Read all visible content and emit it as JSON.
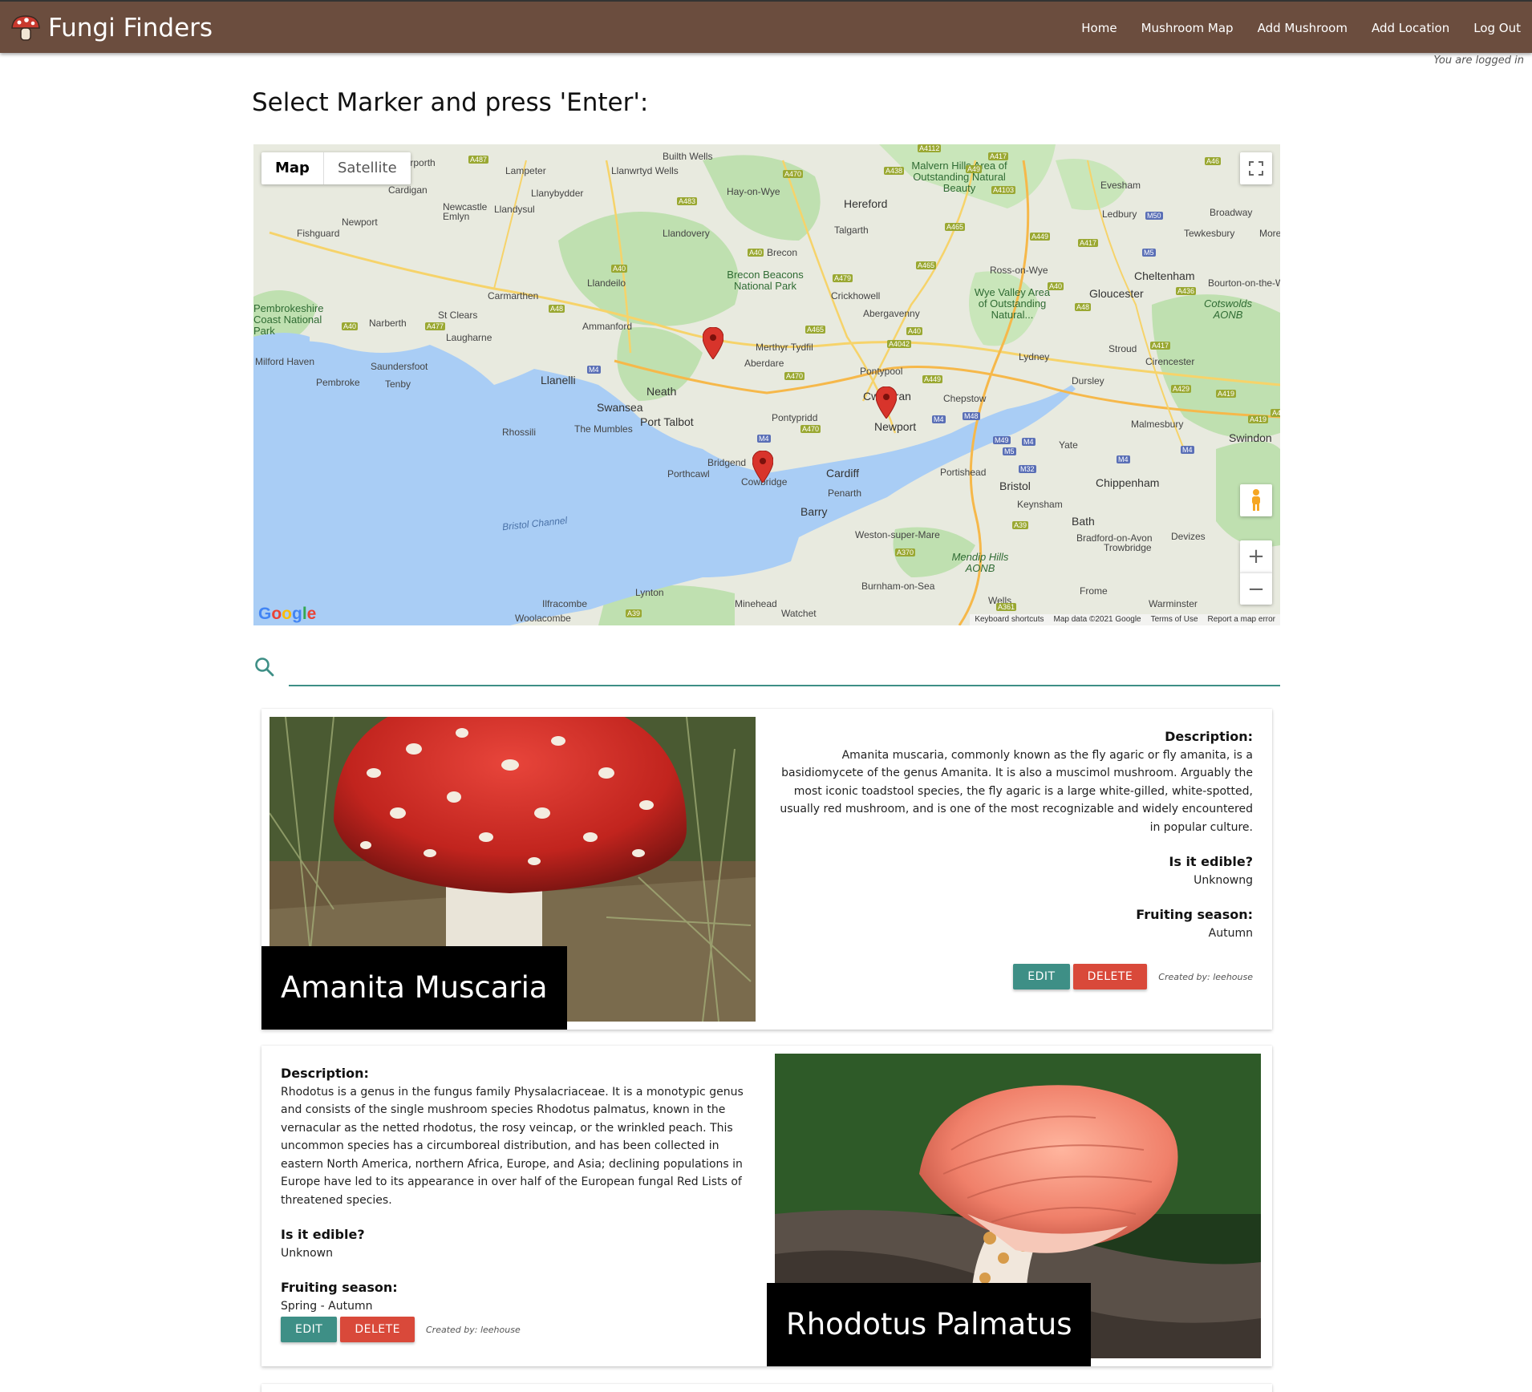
{
  "navbar": {
    "brand": "Fungi Finders",
    "links": [
      "Home",
      "Mushroom Map",
      "Add Mushroom",
      "Add Location",
      "Log Out"
    ],
    "status": "You are logged in"
  },
  "page": {
    "heading": "Select Marker and press 'Enter':"
  },
  "map": {
    "toggle": {
      "map": "Map",
      "satellite": "Satellite"
    },
    "fullscreen_icon": "fullscreen-icon",
    "pegman_icon": "pegman-icon",
    "zoom_in": "+",
    "zoom_out": "−",
    "logo": "Google",
    "footer": [
      "Keyboard shortcuts",
      "Map data ©2021 Google",
      "Terms of Use",
      "Report a map error"
    ],
    "places": [
      "Aberporth",
      "Lampeter",
      "Llanwrtyd Wells",
      "Builth Wells",
      "Hay-on-Wye",
      "Hereford",
      "Malvern Hills Area of Outstanding Natural Beauty",
      "Evesham",
      "Cardigan",
      "Llanybydder",
      "Newcastle Emlyn",
      "Llandysul",
      "Newport",
      "Fishguard",
      "Llandovery",
      "Talgarth",
      "Ledbury",
      "Broadway",
      "Tewkesbury",
      "Moreton-in",
      "Brecon",
      "Brecon Beacons National Park",
      "Llandeilo",
      "Ross-on-Wye",
      "Cheltenham",
      "Carmarthen",
      "Crickhowell",
      "Wye Valley Area of Outstanding Natural...",
      "Gloucester",
      "Bourton-on-the-W",
      "Pembrokeshire Coast National Park",
      "St Clears",
      "Narberth",
      "Ammanford",
      "Abergavenny",
      "Cotswolds AONB",
      "Laugharne",
      "Merthyr Tydfil",
      "Aberdare",
      "Stroud",
      "Milford Haven",
      "Saundersfoot",
      "Pontypool",
      "Lydney",
      "Cirencester",
      "Pembroke",
      "Tenby",
      "Llanelli",
      "Neath",
      "Dursley",
      "Swansea",
      "Cwmbran",
      "Chepstow",
      "Port Talbot",
      "Pontypridd",
      "Newport",
      "Malmesbury",
      "Swindon",
      "Rhossili",
      "The Mumbles",
      "Yate",
      "Bridgend",
      "Cardiff",
      "Portishead",
      "Porthcawl",
      "Cowbridge",
      "Bristol",
      "Chippenham",
      "Penarth",
      "Keynsham",
      "Barry",
      "Bath",
      "Bristol Channel",
      "Weston-super-Mare",
      "Bradford-on-Avon",
      "Devizes",
      "Trowbridge",
      "Mendip Hills AONB",
      "Burnham-on-Sea",
      "Frome",
      "Ilfracombe",
      "Lynton",
      "Minehead",
      "Wells",
      "Warminster",
      "Woolacombe",
      "Watchet"
    ],
    "roads": [
      "A487",
      "A470",
      "A4112",
      "A417",
      "A46",
      "A438",
      "A49",
      "A4103",
      "A483",
      "A465",
      "M50",
      "A449",
      "A417",
      "M5",
      "A40",
      "A40",
      "A479",
      "A465",
      "A48",
      "A40",
      "A48",
      "A436",
      "A477",
      "A465",
      "A40",
      "A4042",
      "A417",
      "A40",
      "M4",
      "A470",
      "A449",
      "M48",
      "A429",
      "A419",
      "A4",
      "M4",
      "A470",
      "M4",
      "M49",
      "M5",
      "M4",
      "A419",
      "M32",
      "M4",
      "M4",
      "A39",
      "A370",
      "A361",
      "A39"
    ]
  },
  "search": {
    "icon": "search-icon",
    "value": "",
    "placeholder": ""
  },
  "mushrooms": [
    {
      "name": "Amanita Muscaria",
      "description_label": "Description:",
      "description": "Amanita muscaria, commonly known as the fly agaric or fly amanita, is a basidiomycete of the genus Amanita. It is also a muscimol mushroom. Arguably the most iconic toadstool species, the fly agaric is a large white-gilled, white-spotted, usually red mushroom, and is one of the most recognizable and widely encountered in popular culture.",
      "edible_label": "Is it edible?",
      "edible": "Unknowng",
      "season_label": "Fruiting season:",
      "season": "Autumn",
      "edit": "EDIT",
      "delete": "DELETE",
      "created_by": "Created by: leehouse"
    },
    {
      "name": "Rhodotus Palmatus",
      "description_label": "Description:",
      "description": "Rhodotus is a genus in the fungus family Physalacriaceae. It is a monotypic genus and consists of the single mushroom species Rhodotus palmatus, known in the vernacular as the netted rhodotus, the rosy veincap, or the wrinkled peach. This uncommon species has a circumboreal distribution, and has been collected in eastern North America, northern Africa, Europe, and Asia; declining populations in Europe have led to its appearance in over half of the European fungal Red Lists of threatened species.",
      "edible_label": "Is it edible?",
      "edible": "Unknown",
      "season_label": "Fruiting season:",
      "season": "Spring - Autumn",
      "edit": "EDIT",
      "delete": "DELETE",
      "created_by": "Created by: leehouse"
    }
  ],
  "colors": {
    "navbar": "#6b4d3e",
    "accent_teal": "#3e8f86",
    "delete_red": "#d9493a",
    "title_bg": "#000000",
    "water": "#a9cdf5",
    "land": "#e8eadf",
    "green": "#bfe0b0"
  }
}
